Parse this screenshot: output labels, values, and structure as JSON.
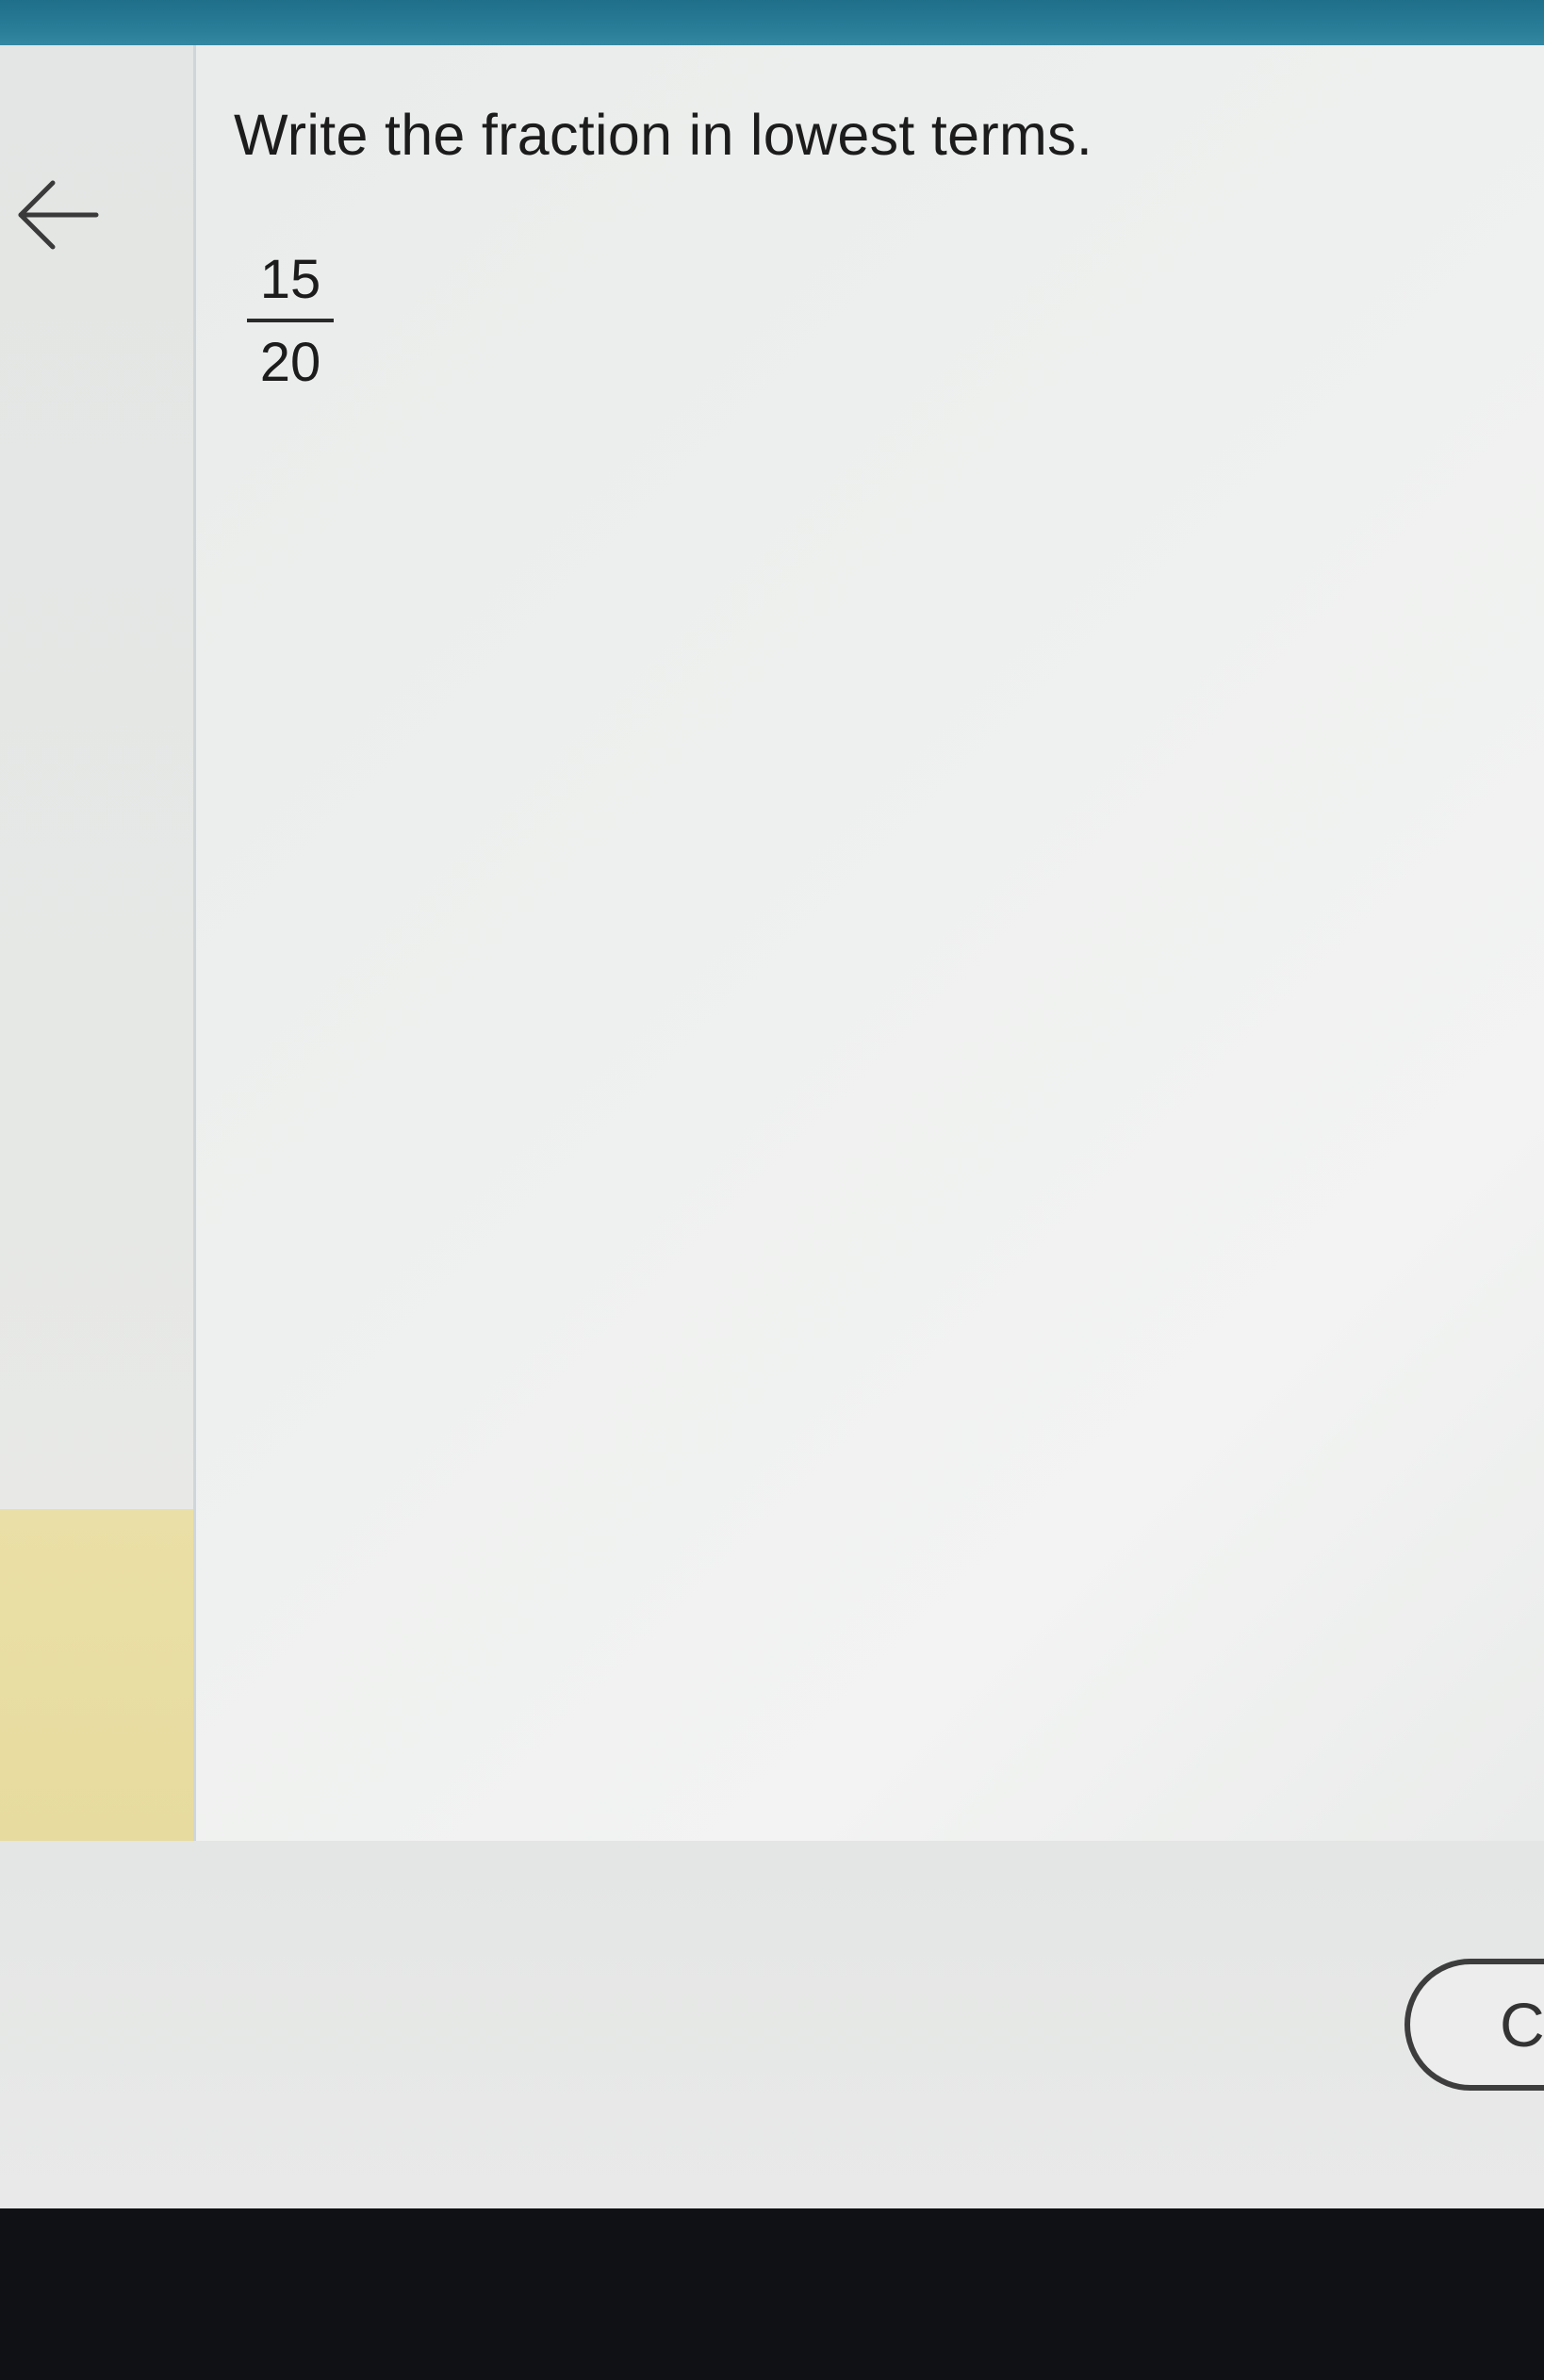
{
  "question": {
    "instruction": "Write the fraction in lowest terms.",
    "fraction": {
      "numerator": "15",
      "denominator": "20"
    }
  },
  "nav": {
    "back_icon": "arrow-left-icon"
  },
  "footer": {
    "check_button_label": "C"
  },
  "colors": {
    "top_bar": "#1f6f8a",
    "rail_highlight": "#eadfa6",
    "text": "#1c1c1c"
  }
}
